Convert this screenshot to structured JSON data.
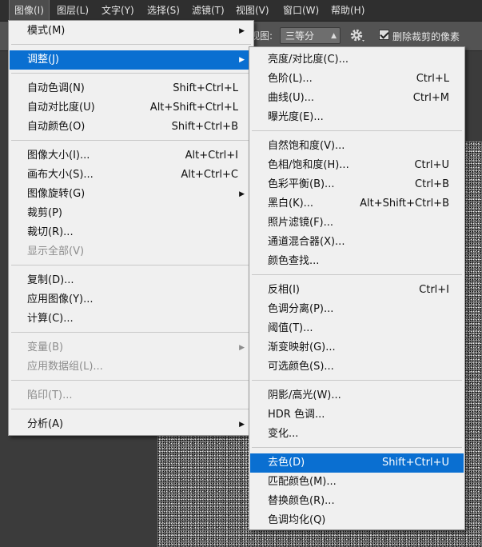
{
  "menubar": {
    "items": [
      {
        "label": "图像(I)"
      },
      {
        "label": "图层(L)"
      },
      {
        "label": "文字(Y)"
      },
      {
        "label": "选择(S)"
      },
      {
        "label": "滤镜(T)"
      },
      {
        "label": "视图(V)"
      },
      {
        "label": "窗口(W)"
      },
      {
        "label": "帮助(H)"
      }
    ]
  },
  "options_bar": {
    "view_label": "视图:",
    "view_value": "三等分",
    "delete_crop_label": "删除裁剪的像素",
    "delete_crop_checked": true
  },
  "image_menu": {
    "items": [
      {
        "label": "模式(M)",
        "shortcut": "",
        "submenu": true
      },
      {
        "label": "调整(J)",
        "shortcut": "",
        "submenu": true,
        "highlighted": true
      },
      {
        "label": "自动色调(N)",
        "shortcut": "Shift+Ctrl+L"
      },
      {
        "label": "自动对比度(U)",
        "shortcut": "Alt+Shift+Ctrl+L"
      },
      {
        "label": "自动颜色(O)",
        "shortcut": "Shift+Ctrl+B"
      },
      {
        "label": "图像大小(I)...",
        "shortcut": "Alt+Ctrl+I"
      },
      {
        "label": "画布大小(S)...",
        "shortcut": "Alt+Ctrl+C"
      },
      {
        "label": "图像旋转(G)",
        "shortcut": "",
        "submenu": true
      },
      {
        "label": "裁剪(P)",
        "shortcut": ""
      },
      {
        "label": "裁切(R)...",
        "shortcut": ""
      },
      {
        "label": "显示全部(V)",
        "shortcut": "",
        "disabled": true
      },
      {
        "label": "复制(D)...",
        "shortcut": ""
      },
      {
        "label": "应用图像(Y)...",
        "shortcut": ""
      },
      {
        "label": "计算(C)...",
        "shortcut": ""
      },
      {
        "label": "变量(B)",
        "shortcut": "",
        "submenu": true,
        "disabled": true
      },
      {
        "label": "应用数据组(L)...",
        "shortcut": "",
        "disabled": true
      },
      {
        "label": "陷印(T)...",
        "shortcut": "",
        "disabled": true
      },
      {
        "label": "分析(A)",
        "shortcut": "",
        "submenu": true
      }
    ]
  },
  "adjust_menu": {
    "items": [
      {
        "label": "亮度/对比度(C)...",
        "shortcut": ""
      },
      {
        "label": "色阶(L)...",
        "shortcut": "Ctrl+L"
      },
      {
        "label": "曲线(U)...",
        "shortcut": "Ctrl+M"
      },
      {
        "label": "曝光度(E)...",
        "shortcut": ""
      },
      {
        "label": "自然饱和度(V)...",
        "shortcut": ""
      },
      {
        "label": "色相/饱和度(H)...",
        "shortcut": "Ctrl+U"
      },
      {
        "label": "色彩平衡(B)...",
        "shortcut": "Ctrl+B"
      },
      {
        "label": "黑白(K)...",
        "shortcut": "Alt+Shift+Ctrl+B"
      },
      {
        "label": "照片滤镜(F)...",
        "shortcut": ""
      },
      {
        "label": "通道混合器(X)...",
        "shortcut": ""
      },
      {
        "label": "颜色查找...",
        "shortcut": ""
      },
      {
        "label": "反相(I)",
        "shortcut": "Ctrl+I"
      },
      {
        "label": "色调分离(P)...",
        "shortcut": ""
      },
      {
        "label": "阈值(T)...",
        "shortcut": ""
      },
      {
        "label": "渐变映射(G)...",
        "shortcut": ""
      },
      {
        "label": "可选颜色(S)...",
        "shortcut": ""
      },
      {
        "label": "阴影/高光(W)...",
        "shortcut": ""
      },
      {
        "label": "HDR 色调...",
        "shortcut": ""
      },
      {
        "label": "变化...",
        "shortcut": ""
      },
      {
        "label": "去色(D)",
        "shortcut": "Shift+Ctrl+U",
        "highlighted": true
      },
      {
        "label": "匹配颜色(M)...",
        "shortcut": ""
      },
      {
        "label": "替换颜色(R)...",
        "shortcut": ""
      },
      {
        "label": "色调均化(Q)",
        "shortcut": ""
      }
    ]
  },
  "colors": {
    "highlight": "#0a6fd1",
    "menu_bg": "#f0f0f0",
    "app_bg": "#3b3b3b"
  }
}
